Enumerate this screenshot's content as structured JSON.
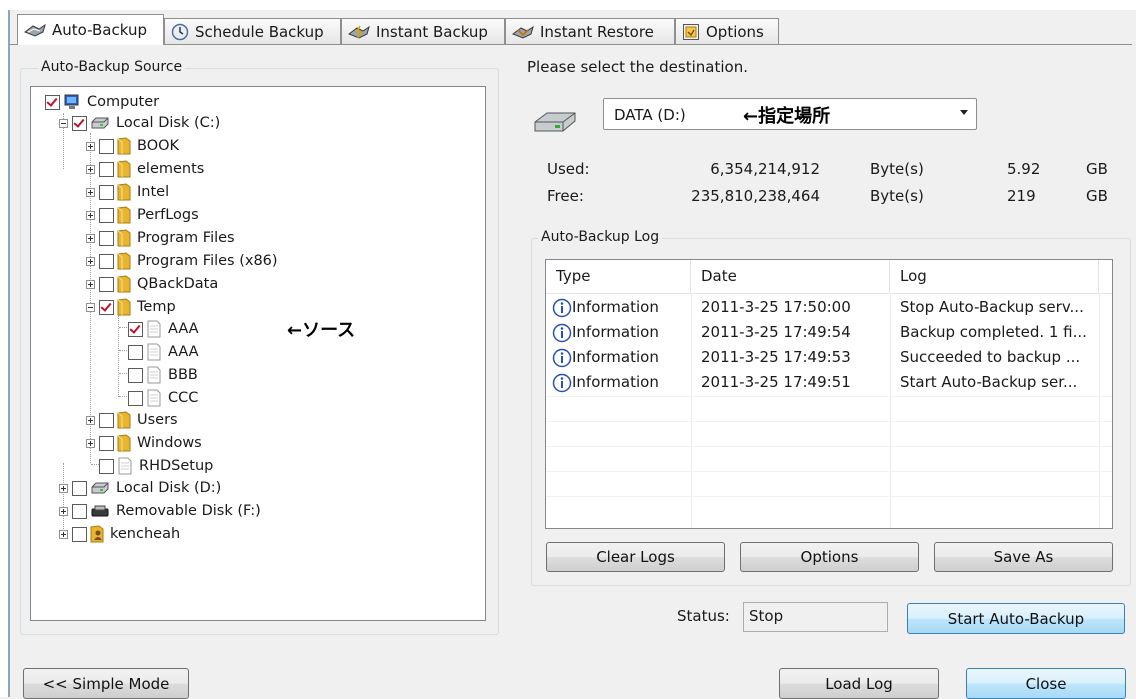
{
  "tabs": [
    {
      "label": "Auto-Backup",
      "icon": "backup-icon",
      "active": true
    },
    {
      "label": "Schedule Backup",
      "icon": "schedule-icon",
      "active": false
    },
    {
      "label": "Instant Backup",
      "icon": "instant-backup-icon",
      "active": false
    },
    {
      "label": "Instant Restore",
      "icon": "instant-restore-icon",
      "active": false
    },
    {
      "label": "Options",
      "icon": "options-icon",
      "active": false
    }
  ],
  "source": {
    "title": "Auto-Backup Source",
    "tree": [
      {
        "label": "Computer",
        "checked": true,
        "icon": "computer-icon"
      },
      {
        "label": "Local Disk (C:)",
        "checked": true,
        "icon": "drive-icon"
      },
      {
        "label": "BOOK",
        "checked": false,
        "icon": "folder-icon"
      },
      {
        "label": "elements",
        "checked": false,
        "icon": "folder-icon"
      },
      {
        "label": "Intel",
        "checked": false,
        "icon": "folder-icon"
      },
      {
        "label": "PerfLogs",
        "checked": false,
        "icon": "folder-icon"
      },
      {
        "label": "Program Files",
        "checked": false,
        "icon": "folder-icon"
      },
      {
        "label": "Program Files (x86)",
        "checked": false,
        "icon": "folder-icon"
      },
      {
        "label": "QBackData",
        "checked": false,
        "icon": "folder-icon"
      },
      {
        "label": "Temp",
        "checked": true,
        "icon": "folder-icon"
      },
      {
        "label": "AAA",
        "checked": true,
        "icon": "file-icon"
      },
      {
        "label": "AAA",
        "checked": false,
        "icon": "file-icon"
      },
      {
        "label": "BBB",
        "checked": false,
        "icon": "file-icon"
      },
      {
        "label": "CCC",
        "checked": false,
        "icon": "file-icon"
      },
      {
        "label": "Users",
        "checked": false,
        "icon": "folder-icon"
      },
      {
        "label": "Windows",
        "checked": false,
        "icon": "folder-icon"
      },
      {
        "label": "RHDSetup",
        "checked": false,
        "icon": "file-icon"
      },
      {
        "label": "Local Disk (D:)",
        "checked": false,
        "icon": "drive-icon"
      },
      {
        "label": "Removable Disk (F:)",
        "checked": false,
        "icon": "removable-drive-icon"
      },
      {
        "label": "kencheah",
        "checked": false,
        "icon": "user-folder-icon"
      }
    ]
  },
  "annotations": {
    "source": "←ソース",
    "destination": "←指定場所"
  },
  "destination": {
    "prompt": "Please select the destination.",
    "selected": "DATA (D:)",
    "used_label": "Used:",
    "used_bytes": "6,354,214,912",
    "used_unit": "Byte(s)",
    "used_size": "5.92",
    "used_size_unit": "GB",
    "free_label": "Free:",
    "free_bytes": "235,810,238,464",
    "free_unit": "Byte(s)",
    "free_size": "219",
    "free_size_unit": "GB"
  },
  "log": {
    "title": "Auto-Backup Log",
    "columns": [
      "Type",
      "Date",
      "Log"
    ],
    "rows": [
      {
        "type": "Information",
        "date": "2011-3-25 17:50:00",
        "log": "Stop Auto-Backup serv..."
      },
      {
        "type": "Information",
        "date": "2011-3-25 17:49:54",
        "log": "Backup completed. 1 fi..."
      },
      {
        "type": "Information",
        "date": "2011-3-25 17:49:53",
        "log": "Succeeded to backup ..."
      },
      {
        "type": "Information",
        "date": "2011-3-25 17:49:51",
        "log": "Start Auto-Backup ser..."
      }
    ],
    "buttons": {
      "clear": "Clear Logs",
      "options": "Options",
      "save": "Save As"
    }
  },
  "status": {
    "label": "Status:",
    "value": "Stop",
    "start_button": "Start Auto-Backup"
  },
  "footer": {
    "simple_mode": "<< Simple Mode",
    "load_log": "Load Log",
    "close": "Close"
  },
  "colors": {
    "folder": "#e8b530",
    "checkmark": "#c0122c",
    "default_button_border": "#3c7fb1",
    "info_icon": "#2850b8"
  }
}
